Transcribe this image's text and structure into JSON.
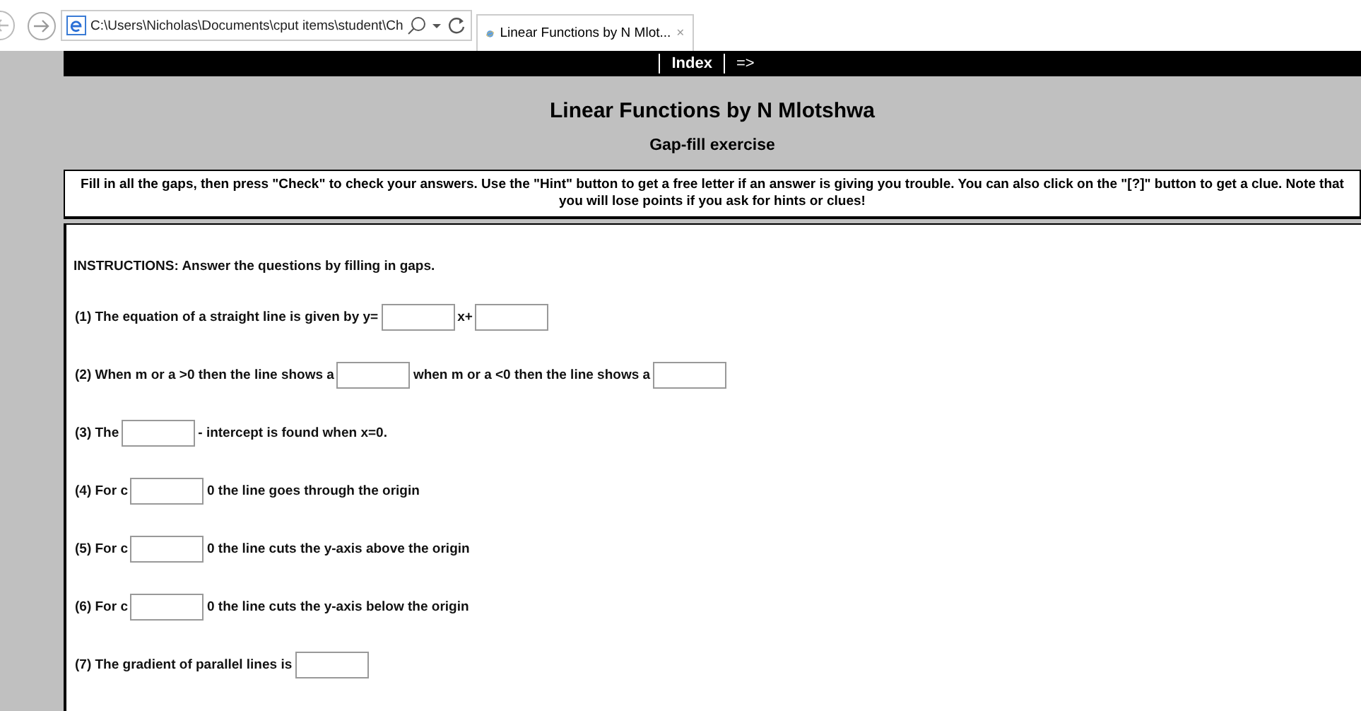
{
  "browser": {
    "address": "C:\\Users\\Nicholas\\Documents\\cput items\\student\\Ch",
    "tab": {
      "title": "Linear Functions by N Mlot...",
      "close": "×"
    }
  },
  "nav": [
    "Index",
    "=>"
  ],
  "title": "Linear Functions by N Mlotshwa",
  "subtitle": "Gap-fill exercise",
  "intro": "Fill in all the gaps, then press \"Check\" to check your answers. Use the \"Hint\" button to get a free letter if an answer is giving you trouble. You can also click on the \"[?]\" button to get a clue. Note that you will lose points if you ask for hints or clues!",
  "instructions": "INSTRUCTIONS: Answer the questions by filling in gaps.",
  "questions": [
    [
      {
        "kind": "text",
        "text": "(1) The equation of a straight line is given by y="
      },
      {
        "kind": "gap"
      },
      {
        "kind": "text",
        "text": "x+"
      },
      {
        "kind": "gap"
      }
    ],
    [
      {
        "kind": "text",
        "text": "(2) When m or a >0 then the line shows a"
      },
      {
        "kind": "gap"
      },
      {
        "kind": "text",
        "text": "when m or a <0 then the line shows a"
      },
      {
        "kind": "gap"
      }
    ],
    [
      {
        "kind": "text",
        "text": "(3) The"
      },
      {
        "kind": "gap"
      },
      {
        "kind": "text",
        "text": "- intercept is found when x=0."
      }
    ],
    [
      {
        "kind": "text",
        "text": "(4) For c"
      },
      {
        "kind": "gap"
      },
      {
        "kind": "text",
        "text": "0 the line goes through the origin"
      }
    ],
    [
      {
        "kind": "text",
        "text": "(5) For c"
      },
      {
        "kind": "gap"
      },
      {
        "kind": "text",
        "text": "0 the line cuts the y-axis above the origin"
      }
    ],
    [
      {
        "kind": "text",
        "text": "(6) For c"
      },
      {
        "kind": "gap"
      },
      {
        "kind": "text",
        "text": "0 the line cuts the y-axis below the origin"
      }
    ],
    [
      {
        "kind": "text",
        "text": "(7) The gradient of parallel lines is"
      },
      {
        "kind": "gap"
      }
    ]
  ]
}
